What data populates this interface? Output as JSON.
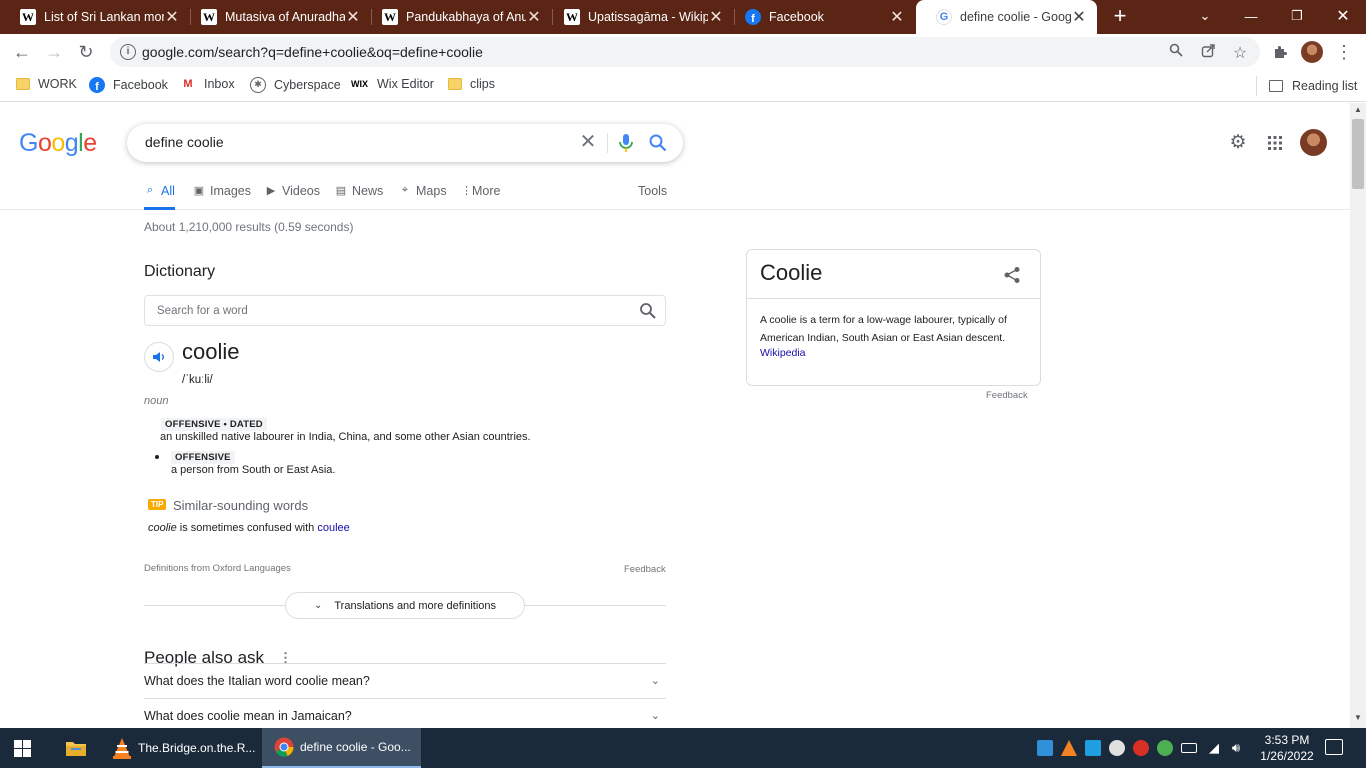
{
  "browser": {
    "tabs": [
      {
        "title": "List of Sri Lankan mon",
        "favicon": "wikipedia-icon"
      },
      {
        "title": "Mutasiva of Anuradha",
        "favicon": "wikipedia-icon"
      },
      {
        "title": "Pandukabhaya of Anu",
        "favicon": "wikipedia-icon"
      },
      {
        "title": "Upatissagāma - Wikip",
        "favicon": "wikipedia-icon"
      },
      {
        "title": "Facebook",
        "favicon": "facebook-icon"
      },
      {
        "title": "define coolie - Google",
        "favicon": "google-icon",
        "active": true
      }
    ],
    "url": "google.com/search?q=define+coolie&oq=define+coolie",
    "bookmarks": [
      {
        "label": "WORK",
        "icon": "folder-icon"
      },
      {
        "label": "Facebook",
        "icon": "facebook-icon"
      },
      {
        "label": "Inbox",
        "icon": "gmail-icon"
      },
      {
        "label": "Cyberspace",
        "icon": "globe-icon"
      },
      {
        "label": "Wix Editor",
        "icon": "wix-icon"
      },
      {
        "label": "clips",
        "icon": "folder-icon"
      }
    ],
    "reading_list": "Reading list"
  },
  "search": {
    "query": "define coolie",
    "tabs": [
      {
        "label": "All",
        "icon": "search-icon",
        "active": true
      },
      {
        "label": "Images",
        "icon": "image-icon"
      },
      {
        "label": "Videos",
        "icon": "play-icon"
      },
      {
        "label": "News",
        "icon": "news-icon"
      },
      {
        "label": "Maps",
        "icon": "map-pin-icon"
      },
      {
        "label": "More",
        "icon": "more-dots-icon"
      }
    ],
    "tools": "Tools",
    "stats": "About 1,210,000 results (0.59 seconds)"
  },
  "dictionary": {
    "heading": "Dictionary",
    "search_placeholder": "Search for a word",
    "word": "coolie",
    "phonetic": "/ˈkuːli/",
    "part_of_speech": "noun",
    "senses": [
      {
        "label": "OFFENSIVE • DATED",
        "definition": "an unskilled native labourer in India, China, and some other Asian countries."
      },
      {
        "label": "OFFENSIVE",
        "definition": "a person from South or East Asia."
      }
    ],
    "tip_badge": "TIP",
    "similar_heading": "Similar-sounding words",
    "confused": {
      "word": "coolie",
      "text": " is sometimes confused with ",
      "link": "coulee"
    },
    "source": "Definitions from Oxford Languages",
    "feedback": "Feedback",
    "more_button": "Translations and more definitions"
  },
  "people_also_ask": {
    "heading": "People also ask",
    "questions": [
      "What does the Italian word coolie mean?",
      "What does coolie mean in Jamaican?"
    ]
  },
  "knowledge_panel": {
    "title": "Coolie",
    "description": "A coolie is a term for a low-wage labourer, typically of American Indian, South Asian or East Asian descent.",
    "source_link": "Wikipedia",
    "feedback": "Feedback"
  },
  "taskbar": {
    "apps": [
      {
        "label": "The.Bridge.on.the.R...",
        "icon": "vlc-icon"
      },
      {
        "label": "define coolie - Goo...",
        "icon": "chrome-icon",
        "active": true
      }
    ],
    "time": "3:53 PM",
    "date": "1/26/2022"
  },
  "colors": {
    "accent": "#1a73e8",
    "link": "#1a0dab",
    "tabbar": "#5a2515",
    "taskbar": "#1b2a3a"
  }
}
